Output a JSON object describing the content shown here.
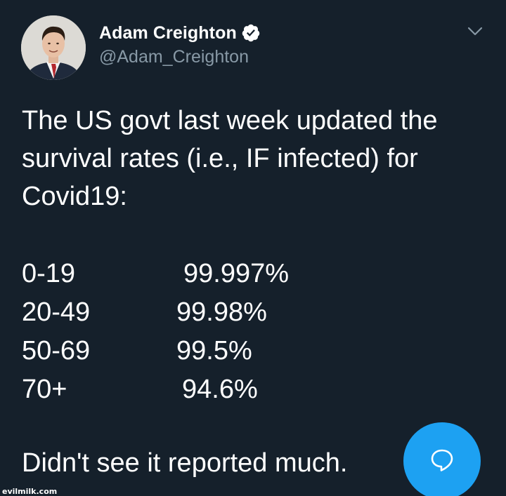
{
  "user": {
    "display_name": "Adam Creighton",
    "handle": "@Adam_Creighton",
    "verified": true
  },
  "tweet": {
    "intro": "The US govt last week updated the survival rates (i.e., IF infected) for Covid19:",
    "rates": [
      {
        "age": "0-19",
        "rate": "99.997%"
      },
      {
        "age": "20-49",
        "rate": "99.98%"
      },
      {
        "age": "50-69",
        "rate": "99.5%"
      },
      {
        "age": "70+",
        "rate": "94.6%"
      }
    ],
    "closing": "Didn't see it reported much."
  },
  "watermark": "evilmilk.com",
  "colors": {
    "background": "#15202b",
    "text": "#ffffff",
    "secondary_text": "#8899a6",
    "accent": "#1da1f2"
  },
  "icons": {
    "verified": "verified-badge-icon",
    "menu": "chevron-down-icon",
    "reply": "speech-bubble-icon"
  }
}
